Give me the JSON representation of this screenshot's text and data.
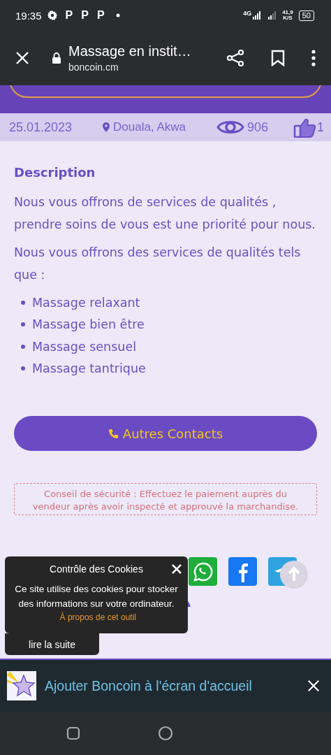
{
  "status_bar": {
    "time": "19:35",
    "notification_letters": [
      "P",
      "P",
      "P"
    ],
    "network": "4G",
    "speed": "41,9",
    "speed_unit": "K/S",
    "battery": "50"
  },
  "browser": {
    "title": "Massage en instit…",
    "url": "boncoin.cm"
  },
  "meta": {
    "date": "25.01.2023",
    "location": "Douala, Akwa",
    "views": "906",
    "likes": "1"
  },
  "description": {
    "heading": "Description",
    "paragraphs": [
      "Nous vous offrons de services de qualités , prendre soins de vous est une priorité pour nous.",
      "Nous vous offrons des services de qualités tels que :"
    ],
    "items": [
      "Massage relaxant",
      "Massage bien être",
      "Massage sensuel",
      "Massage tantrique"
    ]
  },
  "contact_button": "Autres Contacts",
  "safety_notice": "Conseil de sécurité : Effectuez le paiement auprès du vendeur après avoir inspecté et approuvé la marchandise.",
  "share": [
    {
      "kind": "whatsapp"
    },
    {
      "kind": "facebook"
    },
    {
      "kind": "telegram"
    }
  ],
  "cookie_popup": {
    "title": "Contrôle des Cookies",
    "message": "Ce site utilise des cookies pour stocker des informations sur votre ordinateur.",
    "link": "À propos de cet outil",
    "more_button": "lire la suite"
  },
  "install_banner": {
    "text": "Ajouter Boncoin à l'écran d'accueil"
  }
}
